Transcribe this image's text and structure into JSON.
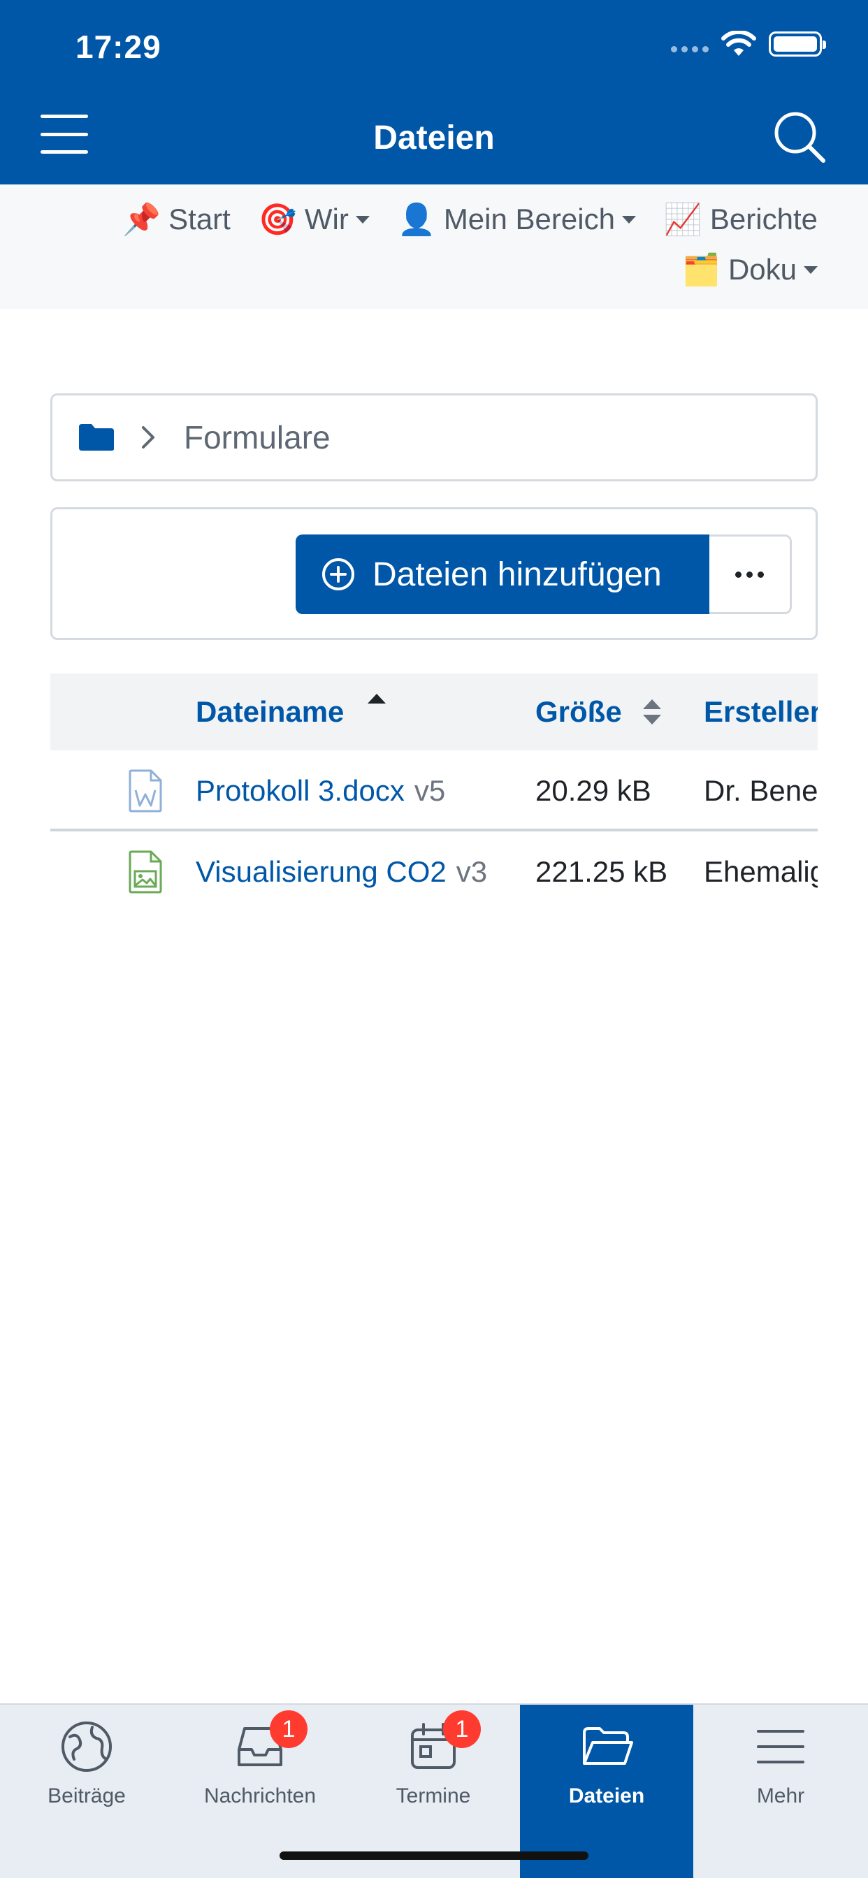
{
  "status_bar": {
    "time": "17:29"
  },
  "header": {
    "title": "Dateien"
  },
  "topnav": {
    "items": [
      {
        "emoji": "📌",
        "label": "Start"
      },
      {
        "emoji": "🎯",
        "label": "Wir"
      },
      {
        "emoji": "👤",
        "label": "Mein Bereich"
      },
      {
        "emoji": "📈",
        "label": "Berichte"
      },
      {
        "emoji": "🗂️",
        "label": "Doku"
      }
    ]
  },
  "breadcrumb": {
    "current": "Formulare"
  },
  "toolbar": {
    "add_label": "Dateien hinzufügen"
  },
  "table": {
    "columns": [
      "Dateiname",
      "Größe",
      "Ersteller"
    ],
    "rows": [
      {
        "name": "Protokoll 3.docx",
        "version": "v5",
        "size": "20.29 kB",
        "creator": "Dr. Bene"
      },
      {
        "name": "Visualisierung CO2",
        "version": "v3",
        "size": "221.25 kB",
        "creator": "Ehemalig"
      }
    ]
  },
  "tabbar": {
    "items": [
      {
        "label": "Beiträge"
      },
      {
        "label": "Nachrichten",
        "badge": "1"
      },
      {
        "label": "Termine",
        "badge": "1"
      },
      {
        "label": "Dateien"
      },
      {
        "label": "Mehr"
      }
    ]
  },
  "colors": {
    "primary": "#0057a8",
    "badge": "#ff3b30",
    "nav_bg": "#f6f8fa",
    "tabbar_bg": "#e8edf3"
  }
}
